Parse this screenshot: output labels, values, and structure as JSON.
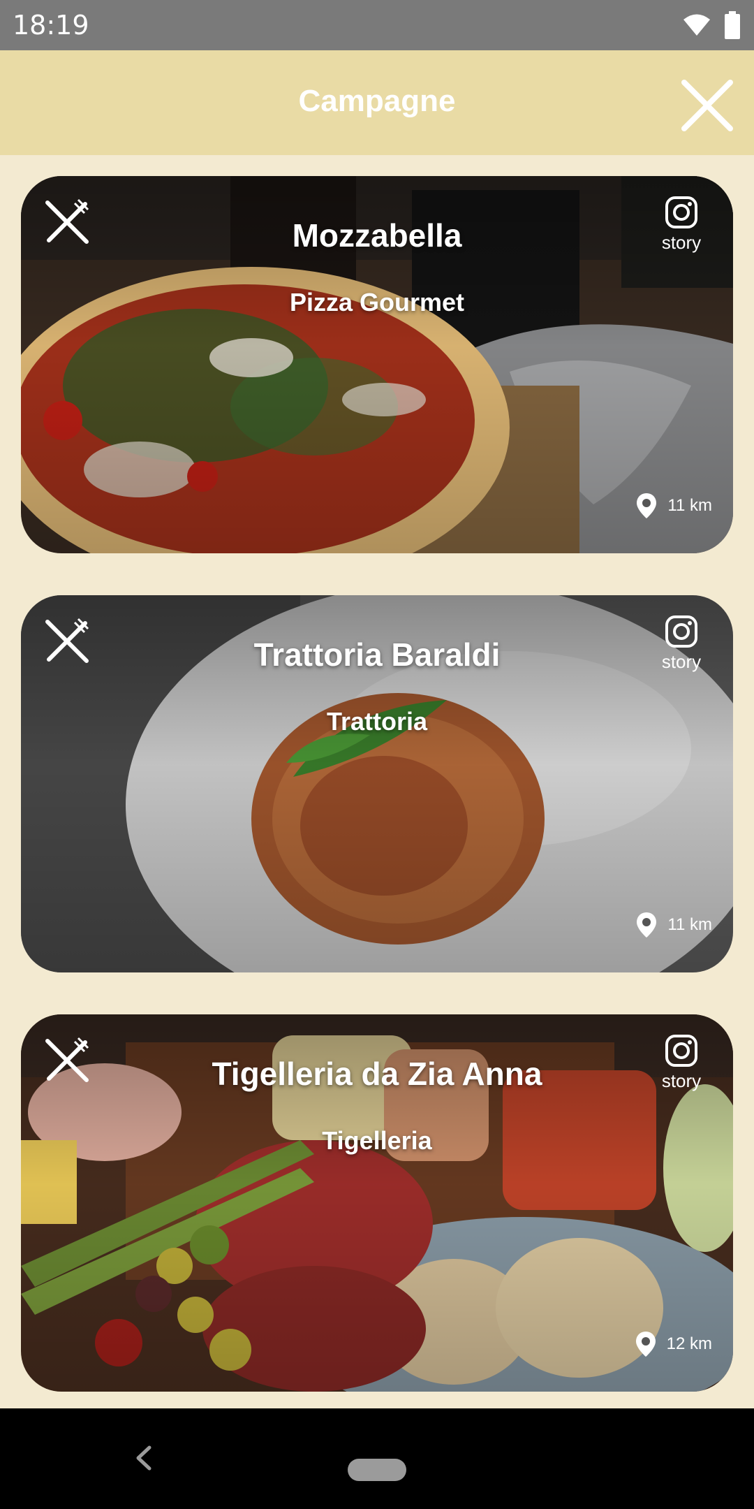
{
  "status_bar": {
    "time": "18:19",
    "icons": [
      "wifi-icon",
      "battery-icon"
    ]
  },
  "header": {
    "title": "Campagne",
    "close_icon": "close-icon"
  },
  "colors": {
    "header_bg": "#e9dba5",
    "page_bg": "#f3ead1",
    "status_bar_bg": "#7a7a7a",
    "nav_bar_bg": "#000000"
  },
  "restaurants": [
    {
      "name": "Mozzabella",
      "category": "Pizza Gourmet",
      "story_label": "story",
      "distance": "11 km",
      "image": "pizza"
    },
    {
      "name": "Trattoria Baraldi",
      "category": "Trattoria",
      "story_label": "story",
      "distance": "11 km",
      "image": "spaghetti"
    },
    {
      "name": "Tigelleria da Zia Anna",
      "category": "Tigelleria",
      "story_label": "story",
      "distance": "12 km",
      "image": "charcuterie"
    }
  ],
  "nav_bar": {
    "icons": [
      "back-icon",
      "home-pill"
    ]
  }
}
